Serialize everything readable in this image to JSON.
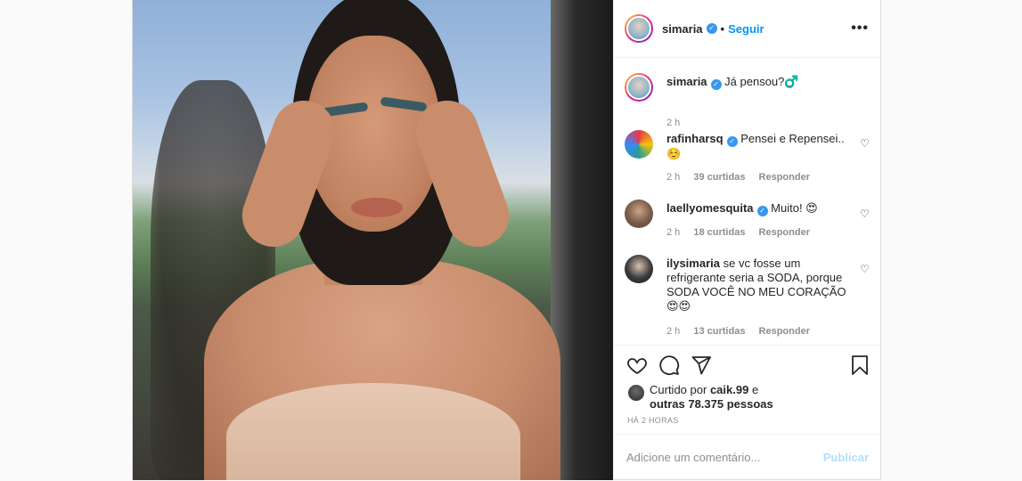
{
  "header": {
    "username": "simaria",
    "separator": "•",
    "follow_label": "Seguir",
    "more_label": "•••"
  },
  "caption": {
    "username": "simaria",
    "text": "Já pensou?♂️",
    "time": "2 h"
  },
  "comments": [
    {
      "username": "rafinharsq",
      "verified": true,
      "text": "Pensei e Repensei.. ☺️",
      "time": "2 h",
      "likes": "39 curtidas",
      "reply_label": "Responder"
    },
    {
      "username": "laellyomesquita",
      "verified": true,
      "text": "Muito! 😍",
      "time": "2 h",
      "likes": "18 curtidas",
      "reply_label": "Responder"
    },
    {
      "username": "ilysimaria",
      "verified": false,
      "text": "se vc fosse um refrigerante seria a SODA, porque SODA VOCÊ NO MEU CORAÇÃO 😍😍",
      "time": "2 h",
      "likes": "13 curtidas",
      "reply_label": "Responder"
    }
  ],
  "likes": {
    "prefix": "Curtido por",
    "user": "caik.99",
    "connector": "e",
    "others": "outras 78.375 pessoas"
  },
  "timestamp": "HÁ 2 HORAS",
  "add_comment": {
    "placeholder": "Adicione um comentário...",
    "publish_label": "Publicar"
  },
  "colors": {
    "accent": "#0095f6",
    "verified": "#3897f0",
    "muted": "#8e8e8e",
    "publish_disabled": "#b2dffc"
  }
}
